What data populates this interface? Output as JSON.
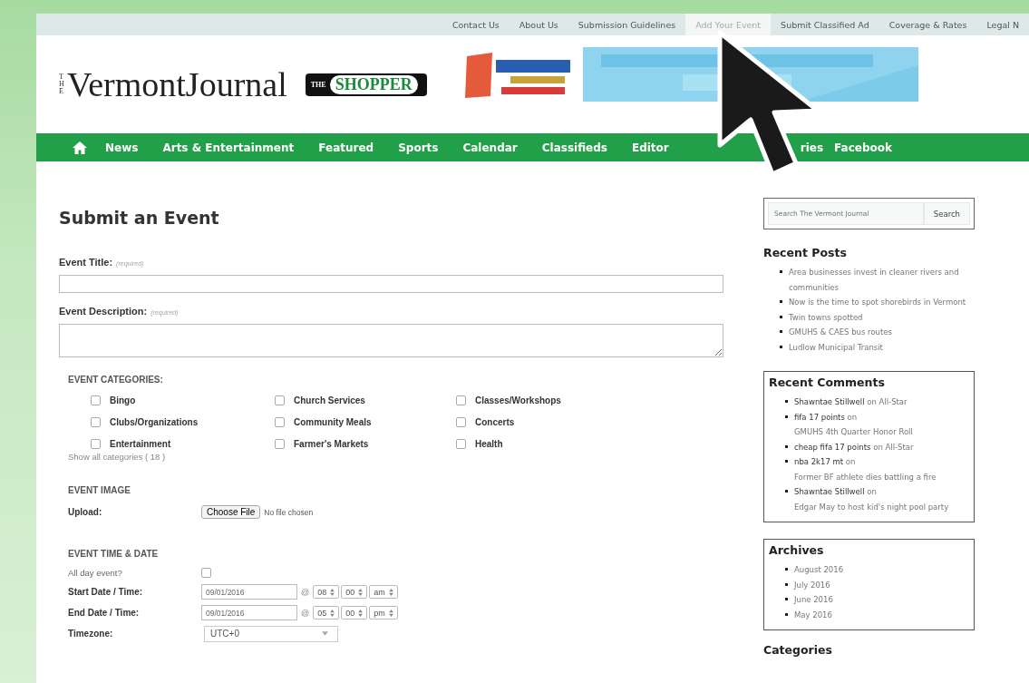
{
  "top_links": [
    {
      "label": "Contact Us",
      "selected": false
    },
    {
      "label": "About Us",
      "selected": false
    },
    {
      "label": "Submission Guidelines",
      "selected": false
    },
    {
      "label": "Add Your Event",
      "selected": true
    },
    {
      "label": "Submit Classified Ad",
      "selected": false
    },
    {
      "label": "Coverage & Rates",
      "selected": false
    },
    {
      "label": "Legal N",
      "selected": false
    }
  ],
  "logo": {
    "prefix": "THE",
    "name": "VermontJournal"
  },
  "shopper_logo": {
    "small": "THE",
    "name": "SHOPPER"
  },
  "main_nav": [
    {
      "label": "News"
    },
    {
      "label": "Arts & Entertainment"
    },
    {
      "label": "Featured"
    },
    {
      "label": "Sports"
    },
    {
      "label": "Calendar"
    },
    {
      "label": "Classifieds"
    },
    {
      "label": "Editor"
    },
    {
      "label": "ries"
    },
    {
      "label": "Facebook"
    }
  ],
  "page_title": "Submit an Event",
  "fields": [
    {
      "label": "Event Title:",
      "hint": "(required)",
      "kind": "line"
    },
    {
      "label": "Event Description:",
      "hint": "(required)",
      "kind": "area"
    }
  ],
  "categories": {
    "heading": "EVENT CATEGORIES:",
    "items": [
      {
        "label": "Bingo",
        "checked": false
      },
      {
        "label": "Church Services",
        "checked": false
      },
      {
        "label": "Classes/Workshops",
        "checked": false
      },
      {
        "label": "Clubs/Organizations",
        "checked": false
      },
      {
        "label": "Community Meals",
        "checked": false
      },
      {
        "label": "Concerts",
        "checked": false
      },
      {
        "label": "Entertainment",
        "checked": false
      },
      {
        "label": "Farmer's Markets",
        "checked": false
      },
      {
        "label": "Health",
        "checked": false
      }
    ],
    "show_all": "Show all categories ( 18 )"
  },
  "image": {
    "heading": "EVENT IMAGE",
    "label": "Upload:",
    "button": "Choose File",
    "status": "No file chosen"
  },
  "time_date": {
    "heading": "EVENT TIME & DATE",
    "all_day": {
      "label": "All day event?",
      "checked": false
    },
    "rows": [
      {
        "label": "Start Date / Time:",
        "date": "09/01/2016",
        "at": "@",
        "hour": "08",
        "minute": "00",
        "ampm": "am"
      },
      {
        "label": "End Date / Time:",
        "date": "09/01/2016",
        "at": "@",
        "hour": "05",
        "minute": "00",
        "ampm": "pm"
      }
    ],
    "timezone": {
      "label": "Timezone:",
      "value": "UTC+0"
    }
  },
  "sidebar": {
    "search": {
      "placeholder": "Search The Vermont Journal",
      "button": "Search"
    },
    "recent_posts": {
      "title": "Recent Posts",
      "items": [
        "Area businesses invest in cleaner rivers and communities",
        "Now is the time to spot shorebirds in Vermont",
        "Twin towns spotted",
        "GMUHS & CAES bus routes",
        "Ludlow Municipal Transit"
      ]
    },
    "recent_comments": {
      "title": "Recent Comments",
      "items": [
        {
          "author": "Shawntae Stillwell",
          "on": "on",
          "post": "All-Star"
        },
        {
          "author": "fifa 17 points",
          "on": "on",
          "post": "GMUHS 4th Quarter Honor Roll"
        },
        {
          "author": "cheap fifa 17 points",
          "on": "on",
          "post": "All-Star"
        },
        {
          "author": "nba 2k17 mt",
          "on": "on",
          "post": "Former BF athlete dies battling a fire"
        },
        {
          "author": "Shawntae Stillwell",
          "on": "on",
          "post": "Edgar May to host kid's night pool party"
        }
      ]
    },
    "archives": {
      "title": "Archives",
      "items": [
        "August 2016",
        "July 2016",
        "June 2016",
        "May 2016"
      ]
    },
    "categories_title": "Categories"
  }
}
